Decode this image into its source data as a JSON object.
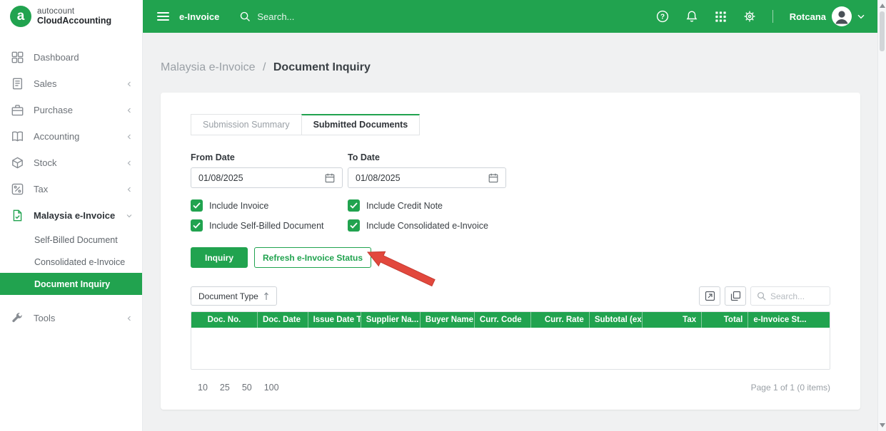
{
  "brand": {
    "logo_letter": "a",
    "line1": "autocount",
    "line2": "CloudAccounting"
  },
  "topbar": {
    "module": "e-Invoice",
    "search_placeholder": "Search...",
    "username": "Rotcana"
  },
  "icons": {
    "help_glyph": "?"
  },
  "sidebar": {
    "items": [
      {
        "label": "Dashboard"
      },
      {
        "label": "Sales"
      },
      {
        "label": "Purchase"
      },
      {
        "label": "Accounting"
      },
      {
        "label": "Stock"
      },
      {
        "label": "Tax"
      },
      {
        "label": "Malaysia e-Invoice"
      },
      {
        "label": "Tools"
      }
    ],
    "subitems": [
      {
        "label": "Self-Billed Document",
        "active": false
      },
      {
        "label": "Consolidated e-Invoice",
        "active": false
      },
      {
        "label": "Document Inquiry",
        "active": true
      }
    ]
  },
  "breadcrumb": {
    "parent": "Malaysia e-Invoice",
    "separator": "/",
    "current": "Document Inquiry"
  },
  "tabs": [
    {
      "label": "Submission Summary",
      "active": false
    },
    {
      "label": "Submitted Documents",
      "active": true
    }
  ],
  "filters": {
    "from_date_label": "From Date",
    "from_date_value": "01/08/2025",
    "to_date_label": "To Date",
    "to_date_value": "01/08/2025",
    "checkboxes": [
      {
        "label": "Include Invoice",
        "checked": true
      },
      {
        "label": "Include Credit Note",
        "checked": true
      },
      {
        "label": "Include Self-Billed Document",
        "checked": true
      },
      {
        "label": "Include Consolidated e-Invoice",
        "checked": true
      }
    ]
  },
  "actions": {
    "inquiry_label": "Inquiry",
    "refresh_label": "Refresh e-Invoice Status"
  },
  "toolbar": {
    "document_type_label": "Document Type",
    "search_placeholder": "Search..."
  },
  "table": {
    "columns": [
      "Doc. No.",
      "Doc. Date",
      "Issue Date T...",
      "Supplier Na...",
      "Buyer Name",
      "Curr. Code",
      "Curr. Rate",
      "Subtotal (ex)",
      "Tax",
      "Total",
      "e-Invoice St..."
    ],
    "rows": []
  },
  "pagination": {
    "sizes": [
      "10",
      "25",
      "50",
      "100"
    ],
    "info": "Page 1 of 1 (0 items)"
  },
  "colors": {
    "primary_green": "#21A34F",
    "arrow_red": "#E2483D"
  }
}
